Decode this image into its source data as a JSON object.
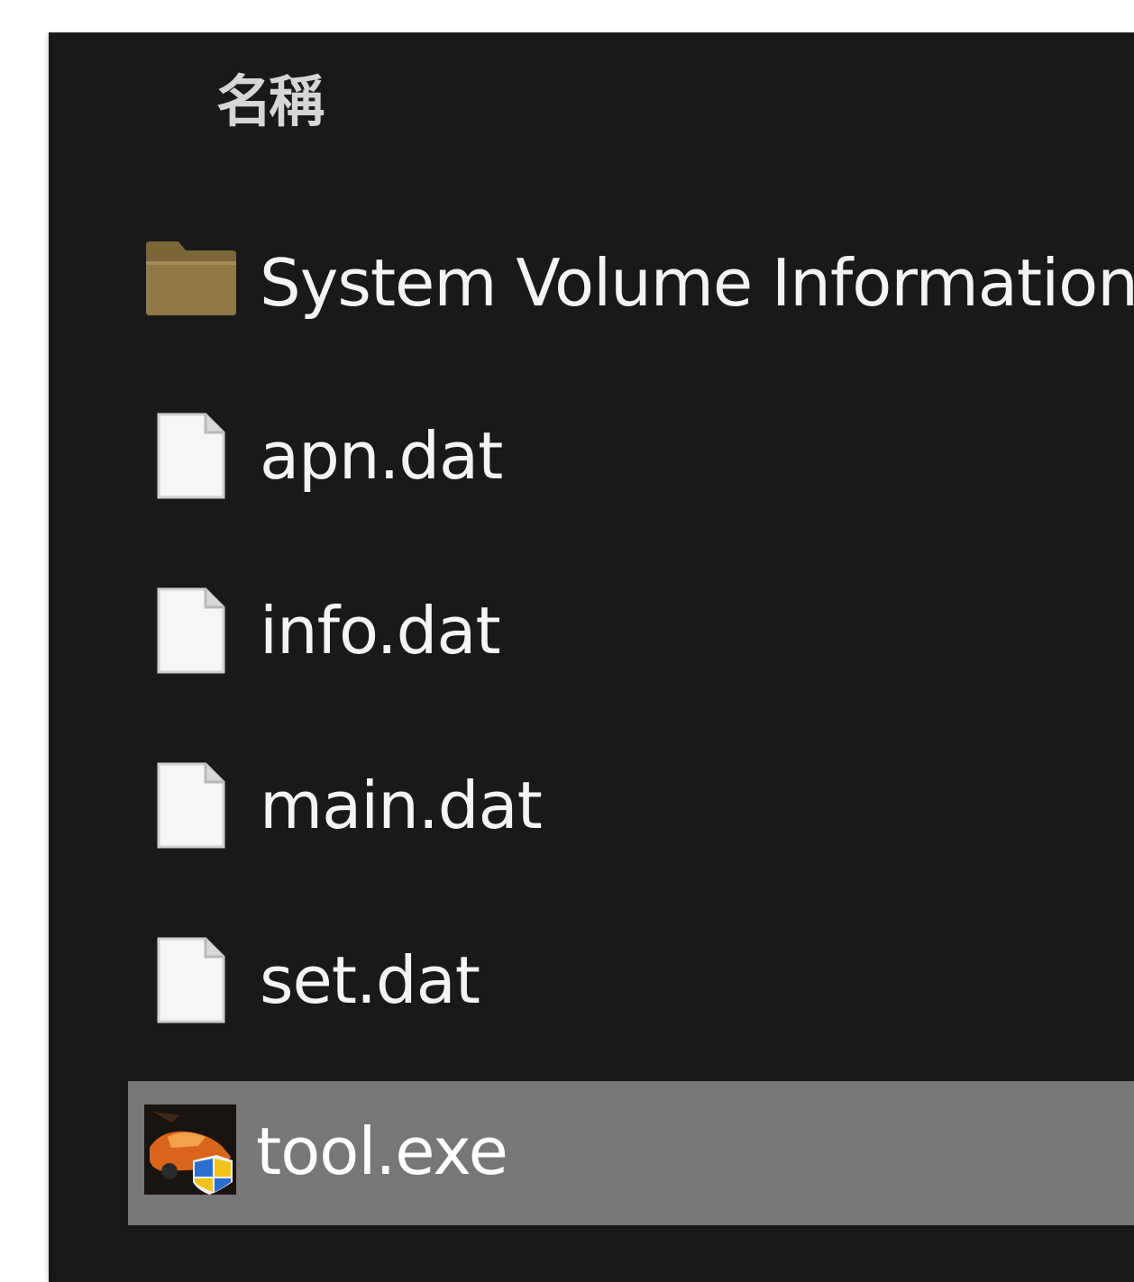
{
  "header": {
    "name_column": "名稱"
  },
  "files": [
    {
      "name": "System Volume Information",
      "icon": "folder-icon",
      "selected": false
    },
    {
      "name": "apn.dat",
      "icon": "file-icon",
      "selected": false
    },
    {
      "name": "info.dat",
      "icon": "file-icon",
      "selected": false
    },
    {
      "name": "main.dat",
      "icon": "file-icon",
      "selected": false
    },
    {
      "name": "set.dat",
      "icon": "file-icon",
      "selected": false
    },
    {
      "name": "tool.exe",
      "icon": "exe-icon",
      "selected": true
    }
  ],
  "colors": {
    "background": "#191919",
    "selection": "#777777",
    "text": "#f4f4f4",
    "folder": "#8a7440"
  }
}
